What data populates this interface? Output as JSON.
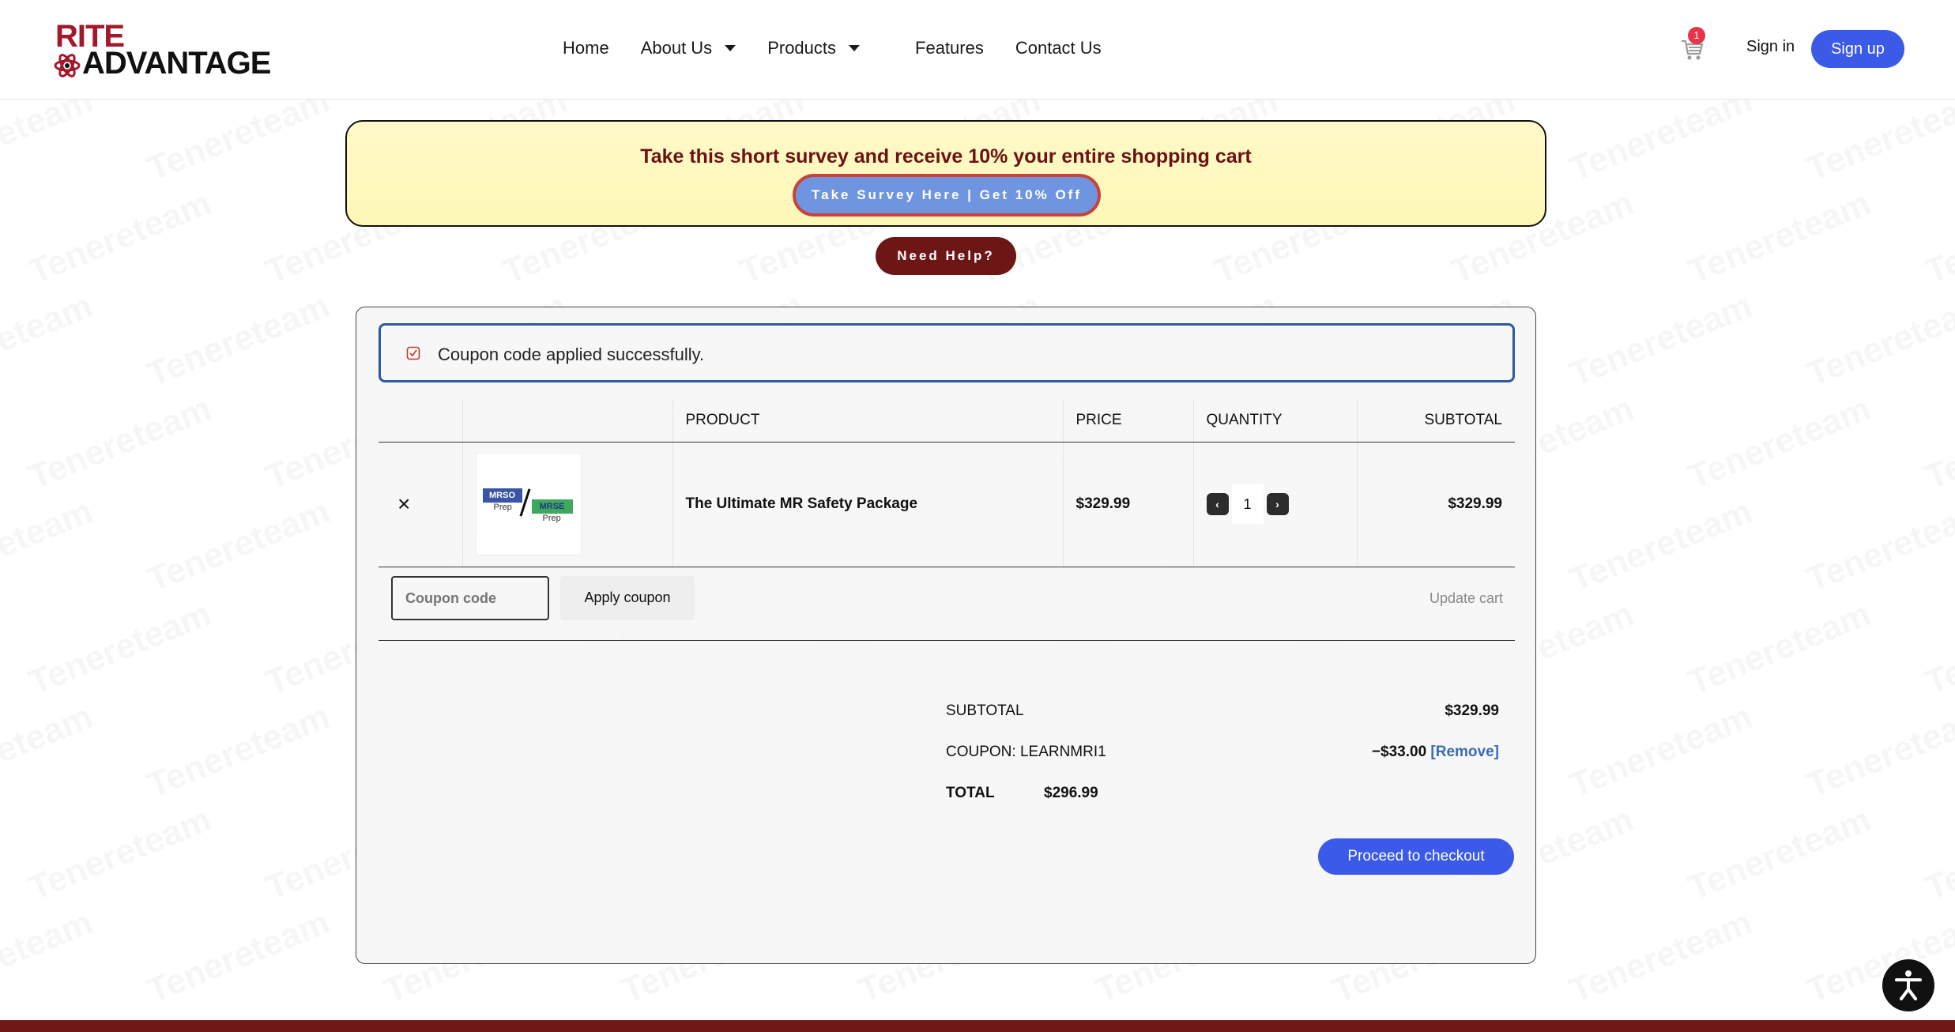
{
  "header": {
    "logo_top": "RITE",
    "logo_bottom": "ADVANTAGE",
    "nav": [
      {
        "label": "Home",
        "dropdown": false
      },
      {
        "label": "About Us",
        "dropdown": true
      },
      {
        "label": "Products",
        "dropdown": true
      },
      {
        "label": "Features",
        "dropdown": false
      },
      {
        "label": "Contact Us",
        "dropdown": false
      }
    ],
    "cart_count": "1",
    "signin": "Sign in",
    "signup": "Sign up"
  },
  "survey": {
    "title": "Take this short survey and receive 10% your entire shopping cart",
    "button": "Take Survey Here | Get 10% Off"
  },
  "help_button": "Need Help?",
  "notice": "Coupon code applied successfully.",
  "table": {
    "headers": [
      "",
      "",
      "PRODUCT",
      "PRICE",
      "QUANTITY",
      "SUBTOTAL"
    ],
    "rows": [
      {
        "thumb_a": "MRSO",
        "thumb_a_sub": "Prep",
        "thumb_b": "MRSE",
        "thumb_b_sub": "Prep",
        "product": "The Ultimate MR Safety Package",
        "price": "$329.99",
        "quantity": "1",
        "subtotal": "$329.99"
      }
    ]
  },
  "coupon": {
    "placeholder": "Coupon code",
    "apply": "Apply coupon",
    "update": "Update cart"
  },
  "totals": {
    "subtotal_label": "SUBTOTAL",
    "subtotal_value": "$329.99",
    "coupon_label": "COUPON: LEARNMRI1",
    "coupon_value": "−$33.00",
    "coupon_remove": "[Remove]",
    "total_label": "TOTAL",
    "total_value": "$296.99"
  },
  "checkout": "Proceed to checkout",
  "colors": {
    "accent": "#3b5ae8",
    "brand": "#a3192c",
    "dark_red": "#6d1616"
  }
}
